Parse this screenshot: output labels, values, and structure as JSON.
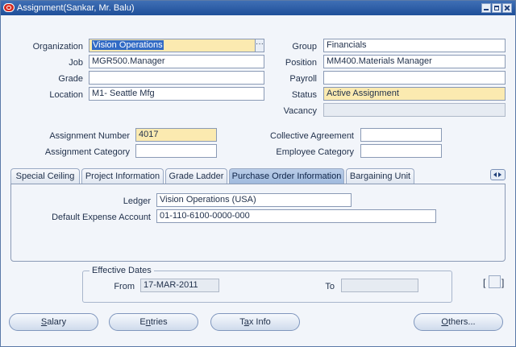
{
  "window": {
    "title": "Assignment(Sankar, Mr. Balu)"
  },
  "fields": {
    "organization": {
      "label": "Organization",
      "value": "Vision Operations"
    },
    "job": {
      "label": "Job",
      "value": "MGR500.Manager"
    },
    "grade": {
      "label": "Grade",
      "value": ""
    },
    "location": {
      "label": "Location",
      "value": "M1- Seattle Mfg"
    },
    "group": {
      "label": "Group",
      "value": "Financials"
    },
    "position": {
      "label": "Position",
      "value": "MM400.Materials Manager"
    },
    "payroll": {
      "label": "Payroll",
      "value": ""
    },
    "status": {
      "label": "Status",
      "value": "Active Assignment"
    },
    "vacancy": {
      "label": "Vacancy",
      "value": ""
    },
    "assignment_number": {
      "label": "Assignment Number",
      "value": "4017"
    },
    "assignment_category": {
      "label": "Assignment Category",
      "value": ""
    },
    "collective_agreement": {
      "label": "Collective Agreement",
      "value": ""
    },
    "employee_category": {
      "label": "Employee Category",
      "value": ""
    }
  },
  "tabs": [
    {
      "label": "Special Ceiling"
    },
    {
      "label": "Project Information"
    },
    {
      "label": "Grade Ladder"
    },
    {
      "label": "Purchase Order Information"
    },
    {
      "label": "Bargaining Unit"
    }
  ],
  "active_tab": "Purchase Order Information",
  "tab_panel": {
    "ledger": {
      "label": "Ledger",
      "value": "Vision Operations (USA)"
    },
    "default_expense_account": {
      "label": "Default Expense Account",
      "value": "01-110-6100-0000-000"
    }
  },
  "effective_dates": {
    "title": "Effective Dates",
    "from_label": "From",
    "from_value": "17-MAR-2011",
    "to_label": "To",
    "to_value": ""
  },
  "buttons": {
    "salary": {
      "mnemonic": "S",
      "rest": "alary"
    },
    "entries": {
      "pre": "E",
      "mnemonic": "n",
      "rest": "tries"
    },
    "tax_info": {
      "pre": "T",
      "mnemonic": "a",
      "rest": "x Info"
    },
    "others": {
      "mnemonic": "O",
      "rest": "thers..."
    }
  },
  "flexfield": {
    "open": "[",
    "close": "]"
  },
  "colors": {
    "title_bar": "#1f4f99",
    "required_field": "#fbeab0",
    "active_tab": "#9fb9dd",
    "form_background": "#f2f5fa",
    "selection": "#316ac5"
  },
  "icons": {
    "app": "oracle-logo-icon",
    "minimize": "minimize-icon",
    "maximize": "maximize-icon",
    "close": "close-icon",
    "lov": "ellipsis-icon",
    "tab_scroll": "tab-scroll-arrows-icon"
  }
}
